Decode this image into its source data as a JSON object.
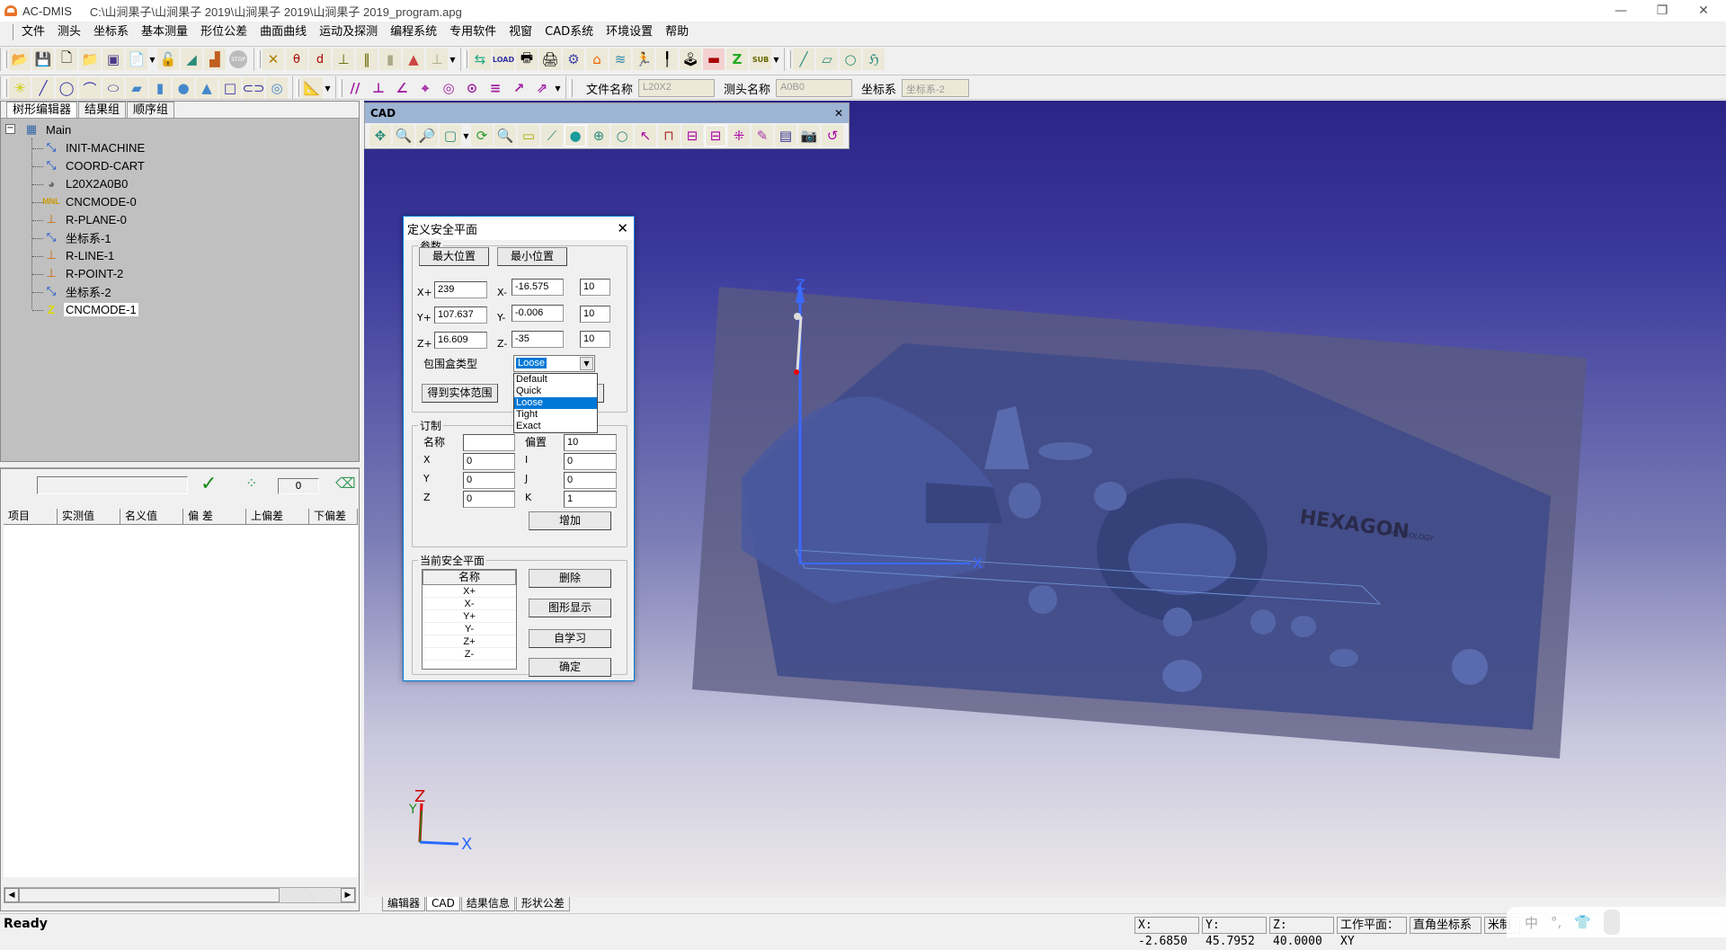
{
  "window": {
    "app_name": "AC-DMIS",
    "file_path": "C:\\山涧果子\\山涧果子 2019\\山涧果子 2019\\山涧果子 2019_program.apg",
    "controls": {
      "minimize": "—",
      "restore": "❐",
      "close": "✕"
    }
  },
  "menu": [
    "文件",
    "测头",
    "坐标系",
    "基本测量",
    "形位公差",
    "曲面曲线",
    "运动及探测",
    "编程系统",
    "专用软件",
    "视窗",
    "CAD系统",
    "环境设置",
    "帮助"
  ],
  "toolbar1": {
    "group1": [
      "open-program-icon",
      "save-as-icon",
      "new-file-icon",
      "open-folder-icon",
      "save-icon",
      "copy-icon",
      "unlock-icon",
      "curve-icon",
      "step-icon",
      "stop-icon"
    ],
    "group2": [
      "intersection-icon",
      "angle-icon",
      "distance-icon",
      "perpendicular-icon",
      "parallel-lines-icon",
      "symmetry-icon",
      "cone-icon",
      "probe-stand-icon"
    ],
    "group3": [
      "coord-transform-icon",
      "load-icon",
      "print-preview-icon",
      "print-icon",
      "settings-icon",
      "home-icon",
      "layers-icon",
      "run-icon",
      "probe-icon",
      "joystick-icon",
      "cnc-icon",
      "z-axis-icon",
      "sub-icon"
    ],
    "group4": [
      "line-icon",
      "rectangle-icon",
      "circle-icon",
      "curve-tool-icon"
    ]
  },
  "toolbar2": {
    "group1": [
      "point-icon",
      "line-measure-icon",
      "circle-measure-icon",
      "arc-icon",
      "ellipse-icon",
      "plane-icon",
      "cylinder-icon",
      "sphere-icon",
      "cone-measure-icon",
      "rect-measure-icon",
      "slot-icon",
      "torus-icon"
    ],
    "group2": [
      "construct-icon"
    ],
    "group3": [
      "parallelism-icon",
      "perpendicularity-icon",
      "angularity-icon",
      "position-icon",
      "concentricity-icon",
      "coaxiality-icon",
      "symmetry-tol-icon",
      "runout-icon",
      "total-runout-icon"
    ],
    "fields": [
      {
        "label": "文件名称",
        "value": "L20X2"
      },
      {
        "label": "测头名称",
        "value": "A0B0"
      },
      {
        "label": "坐标系",
        "value": "坐标系-2"
      }
    ]
  },
  "left_panel": {
    "tabs": [
      "树形编辑器",
      "结果组",
      "顺序组"
    ],
    "active_tab": 0,
    "tree": {
      "root": "Main",
      "items": [
        {
          "label": "INIT-MACHINE",
          "icon": "coordinate-icon"
        },
        {
          "label": "COORD-CART",
          "icon": "coordinate-icon"
        },
        {
          "label": "L20X2A0B0",
          "icon": "probe-icon"
        },
        {
          "label": "CNCMODE-0",
          "icon": "manual-mode-icon"
        },
        {
          "label": "R-PLANE-0",
          "icon": "probe-touch-icon"
        },
        {
          "label": "坐标系-1",
          "icon": "coordinate-icon"
        },
        {
          "label": "R-LINE-1",
          "icon": "probe-touch-icon"
        },
        {
          "label": "R-POINT-2",
          "icon": "probe-touch-icon"
        },
        {
          "label": "坐标系-2",
          "icon": "coordinate-icon"
        },
        {
          "label": "CNCMODE-1",
          "icon": "cnc-mode-icon",
          "selected": true
        }
      ]
    }
  },
  "results_panel": {
    "input_value": "",
    "counter": "0",
    "columns": [
      "项目",
      "实测值",
      "名义值",
      "偏 差",
      "上偏差",
      "下偏差"
    ],
    "rows": []
  },
  "cad_window": {
    "title": "CAD",
    "close": "✕",
    "tools": [
      "pan-icon",
      "zoom-window-icon",
      "zoom-in-out-icon",
      "view-cube-icon",
      "rotate-icon",
      "zoom-fit-icon",
      "select-face-icon",
      "select-edge-icon",
      "shaded-icon",
      "wireframe-icon",
      "hidden-line-icon",
      "pick-point-icon",
      "fixture-icon",
      "select-window-icon",
      "select-multi-icon",
      "grid-points-icon",
      "clear-icon",
      "display-icon",
      "screenshot-icon",
      "reset-icon"
    ]
  },
  "dialog": {
    "title": "定义安全平面",
    "params_group": "参数",
    "max_pos_button": "最大位置",
    "min_pos_button": "最小位置",
    "x_plus": {
      "label": "X+",
      "value": "239"
    },
    "x_minus": {
      "label": "X-",
      "value": "-16.575",
      "offset": "10"
    },
    "y_plus": {
      "label": "Y+",
      "value": "107.637"
    },
    "y_minus": {
      "label": "Y-",
      "value": "-0.006",
      "offset": "10"
    },
    "z_plus": {
      "label": "Z+",
      "value": "16.609"
    },
    "z_minus": {
      "label": "Z-",
      "value": "-35",
      "offset": "10"
    },
    "bbox_label": "包围盒类型",
    "bbox_selected": "Loose",
    "bbox_options": [
      "Default",
      "Quick",
      "Loose",
      "Tight",
      "Exact"
    ],
    "get_extent_button": "得到实体范围",
    "custom_group": "订制",
    "name_label": "名称",
    "name_value": "",
    "offset_label": "偏置",
    "offset_value": "10",
    "x_label": "X",
    "x_value": "0",
    "y_label": "Y",
    "y_value": "0",
    "z_label": "Z",
    "z_value": "0",
    "i_label": "I",
    "i_value": "0",
    "j_label": "J",
    "j_value": "0",
    "k_label": "K",
    "k_value": "1",
    "add_button": "增加",
    "current_group": "当前安全平面",
    "list_header": "名称",
    "list_items": [
      "X+",
      "X-",
      "Y+",
      "Y-",
      "Z+",
      "Z-"
    ],
    "delete_button": "删除",
    "graphic_button": "图形显示",
    "learn_button": "自学习",
    "ok_button": "确定"
  },
  "viewport": {
    "axis_labels": {
      "x": "X",
      "y": "Y",
      "z": "Z"
    },
    "part_logo": "HEXAGON",
    "part_logo_sub": "METROLOGY",
    "legend_colors": [
      "#ff0000",
      "#ff5a00",
      "#ffaa00",
      "#ffff00",
      "#aaff00",
      "#00ff00",
      "#00ffaa",
      "#00ffff",
      "#00aaff",
      "#0055ff",
      "#0000ff"
    ]
  },
  "bottom_tabs": [
    "编辑器",
    "CAD",
    "结果信息",
    "形状公差"
  ],
  "bottom_active": 1,
  "status": {
    "ready": "Ready",
    "x": "X: -2.6850",
    "y": "Y: 45.7952",
    "z": "Z: 40.0000",
    "workplane": "工作平面：XY",
    "coord_sys": "直角坐标系",
    "unit": "米制"
  },
  "ime": {
    "mode": "中",
    "punct": "°,",
    "skin": "👕"
  }
}
